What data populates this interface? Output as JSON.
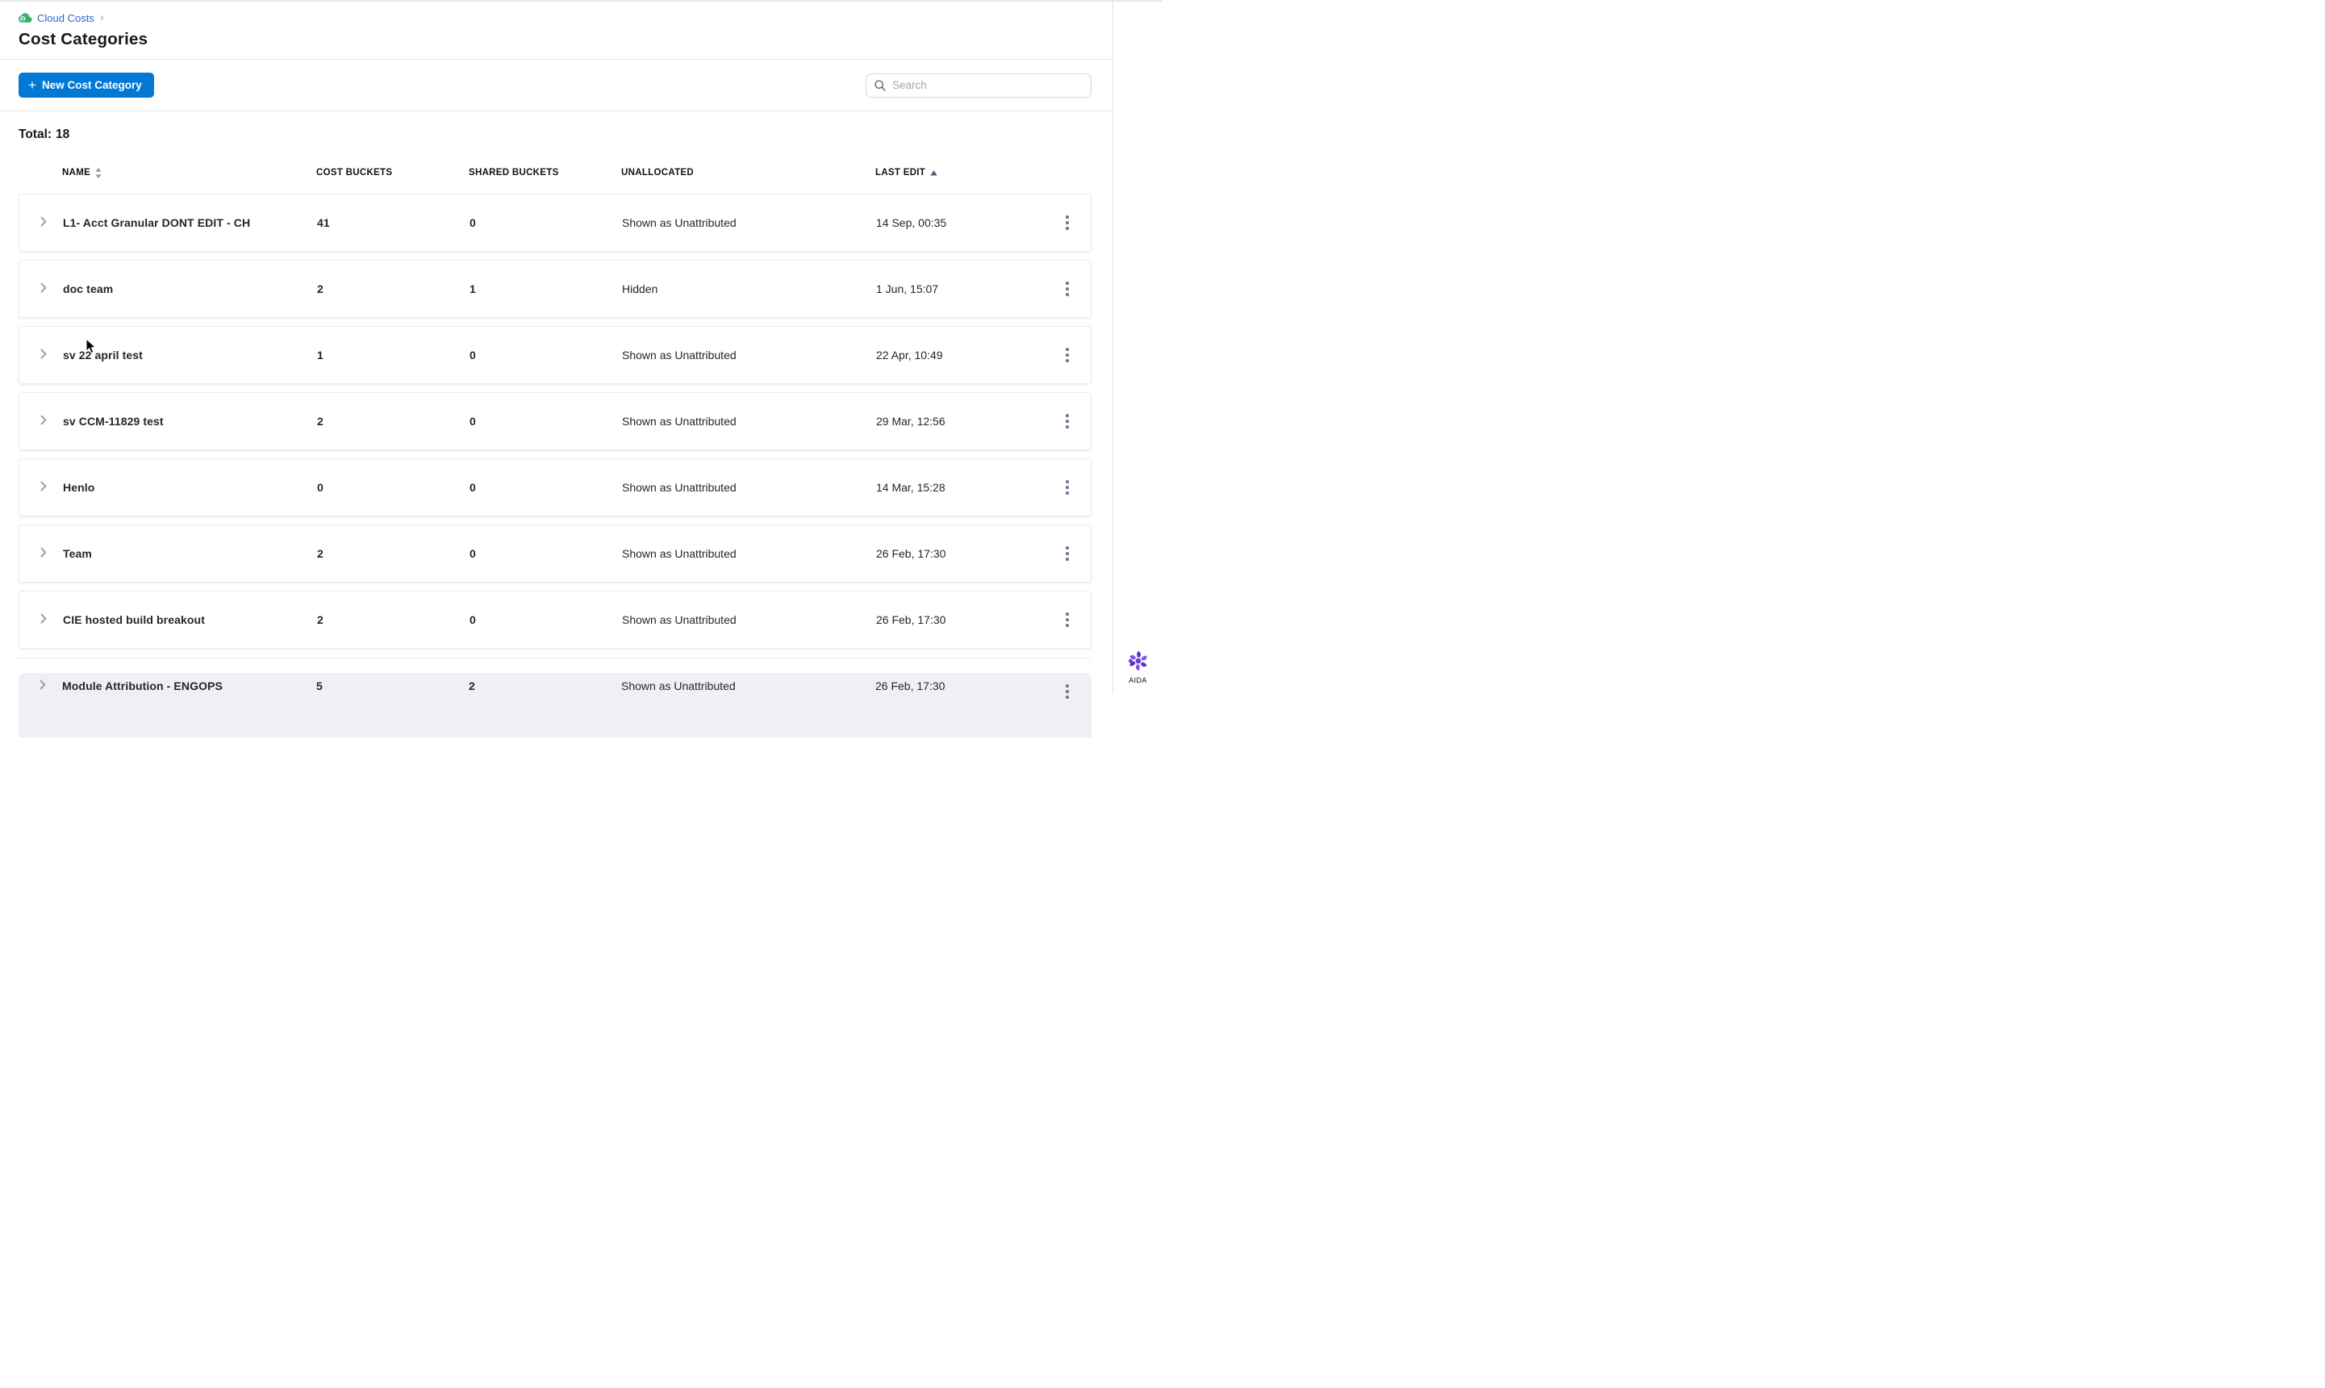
{
  "breadcrumb": {
    "label": "Cloud Costs",
    "separator": "›"
  },
  "page": {
    "title": "Cost Categories"
  },
  "toolbar": {
    "new_button": "New Cost Category",
    "plus": "+",
    "search_placeholder": "Search"
  },
  "summary": {
    "total_label": "Total:",
    "total_value": "18"
  },
  "table": {
    "columns": [
      "NAME",
      "COST BUCKETS",
      "SHARED BUCKETS",
      "UNALLOCATED",
      "LAST EDIT"
    ],
    "sort": {
      "active_column": "LAST EDIT",
      "direction": "asc"
    },
    "rows": [
      {
        "name": "L1- Acct Granular DONT EDIT - CH",
        "cost_buckets": "41",
        "shared_buckets": "0",
        "unallocated": "Shown as Unattributed",
        "last_edit": "14 Sep, 00:35"
      },
      {
        "name": "doc team",
        "cost_buckets": "2",
        "shared_buckets": "1",
        "unallocated": "Hidden",
        "last_edit": "1 Jun, 15:07"
      },
      {
        "name": "sv 22 april test",
        "cost_buckets": "1",
        "shared_buckets": "0",
        "unallocated": "Shown as Unattributed",
        "last_edit": "22 Apr, 10:49"
      },
      {
        "name": "sv CCM-11829 test",
        "cost_buckets": "2",
        "shared_buckets": "0",
        "unallocated": "Shown as Unattributed",
        "last_edit": "29 Mar, 12:56"
      },
      {
        "name": "Henlo",
        "cost_buckets": "0",
        "shared_buckets": "0",
        "unallocated": "Shown as Unattributed",
        "last_edit": "14 Mar, 15:28"
      },
      {
        "name": "Team",
        "cost_buckets": "2",
        "shared_buckets": "0",
        "unallocated": "Shown as Unattributed",
        "last_edit": "26 Feb, 17:30"
      },
      {
        "name": "CIE hosted build breakout",
        "cost_buckets": "2",
        "shared_buckets": "0",
        "unallocated": "Shown as Unattributed",
        "last_edit": "26 Feb, 17:30"
      },
      {
        "name": "Module Attribution - ENGOPS",
        "cost_buckets": "5",
        "shared_buckets": "2",
        "unallocated": "Shown as Unattributed",
        "last_edit": "26 Feb, 17:30",
        "partial": true
      }
    ]
  },
  "assistant": {
    "label": "AIDA"
  },
  "colors": {
    "primary_blue": "#0278d5",
    "link_blue": "#1f6bd3",
    "ccm_green": "#35b26a",
    "aida_purple": "#6a3de0",
    "border": "#e2e4e9",
    "partial_row_bg": "#eef0f3"
  }
}
